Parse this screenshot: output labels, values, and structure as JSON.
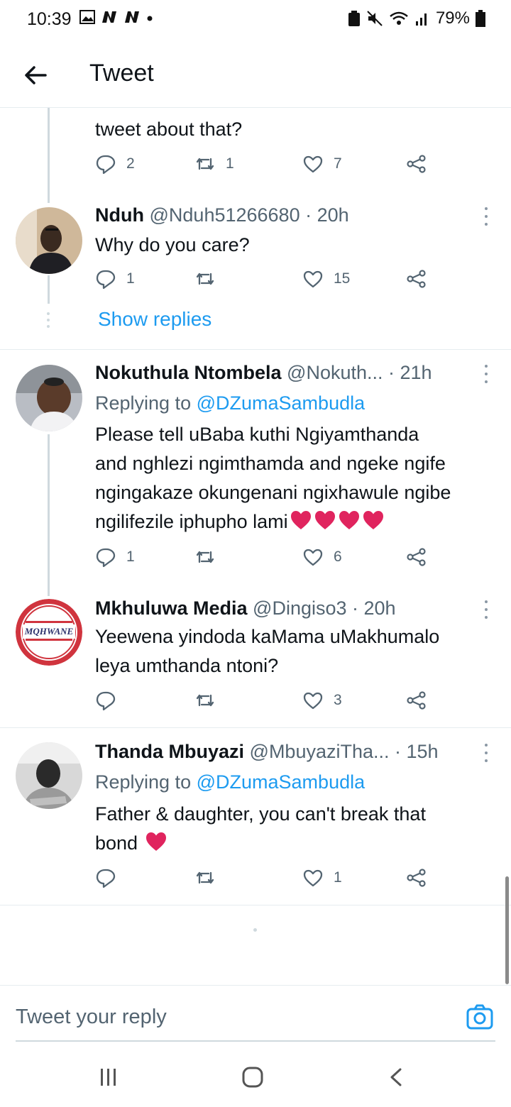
{
  "status_bar": {
    "time": "10:39",
    "battery": "79%"
  },
  "header": {
    "title": "Tweet"
  },
  "tweets": [
    {
      "text": "tweet about that?",
      "replies": "2",
      "retweets": "1",
      "likes": "7"
    },
    {
      "name": "Nduh",
      "handle": "@Nduh51266680",
      "time": "· 20h",
      "text": "Why do you care?",
      "replies": "1",
      "retweets": "",
      "likes": "15"
    },
    {
      "name": "Nokuthula Ntombela",
      "handle": "@Nokuth...",
      "time": "· 21h",
      "replying_prefix": "Replying to",
      "replying_to": "@DZumaSambudla",
      "text_lines": [
        "Please tell uBaba kuthi Ngiyamthanda",
        "and nghlezi ngimthamda and ngeke ngife",
        "ngingakaze okungenani ngixhawule ngibe",
        "ngilifezile iphupho lami"
      ],
      "replies": "1",
      "retweets": "",
      "likes": "6"
    },
    {
      "name": "Mkhuluwa Media",
      "handle": "@Dingiso3",
      "time": "· 20h",
      "text_lines": [
        "Yeewena yindoda kaMama uMakhumalo",
        "leya umthanda ntoni?"
      ],
      "avatar_text": "MQHWANE",
      "replies": "",
      "retweets": "",
      "likes": "3"
    },
    {
      "name": "Thanda Mbuyazi",
      "handle": "@MbuyaziTha...",
      "time": "· 15h",
      "replying_prefix": "Replying to",
      "replying_to": "@DZumaSambudla",
      "text_lines": [
        "Father & daughter, you can't break that",
        "bond"
      ],
      "replies": "",
      "retweets": "",
      "likes": "1"
    }
  ],
  "show_replies": "Show replies",
  "reply_box": {
    "placeholder": "Tweet your reply"
  },
  "icons": [
    "back-arrow-icon",
    "reply-icon",
    "retweet-icon",
    "like-icon",
    "share-icon",
    "more-icon",
    "camera-icon",
    "recents-icon",
    "home-icon",
    "nav-back-icon"
  ],
  "colors": {
    "link": "#1d9bf0",
    "heart": "#e0245e",
    "thread": "#cfd9de",
    "muted": "#536471"
  }
}
